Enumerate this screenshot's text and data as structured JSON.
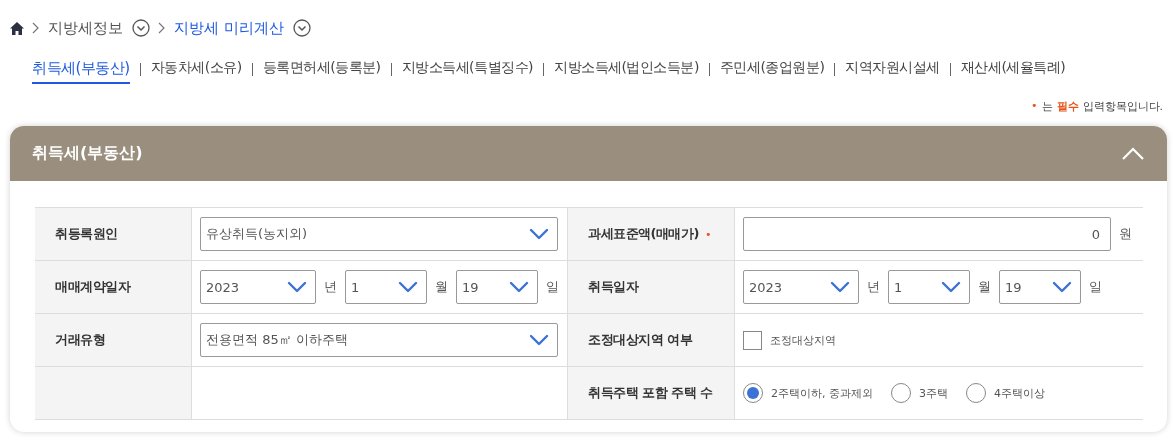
{
  "breadcrumb": [
    {
      "label": "지방세정보",
      "selected": false,
      "has_menu": true
    },
    {
      "label": "지방세 미리계산",
      "selected": true,
      "has_menu": true
    }
  ],
  "tabs": [
    {
      "label": "취득세(부동산)",
      "selected": true
    },
    {
      "label": "자동차세(소유)",
      "selected": false
    },
    {
      "label": "등록면허세(등록분)",
      "selected": false
    },
    {
      "label": "지방소득세(특별징수)",
      "selected": false
    },
    {
      "label": "지방소득세(법인소득분)",
      "selected": false
    },
    {
      "label": "주민세(종업원분)",
      "selected": false
    },
    {
      "label": "지역자원시설세",
      "selected": false
    },
    {
      "label": "재산세(세율특례)",
      "selected": false
    }
  ],
  "required_note": {
    "mark": "•",
    "before": "는",
    "emphasis": "필수",
    "after": "입력항목입니다."
  },
  "panel": {
    "title": "취득세(부동산)",
    "expanded": true,
    "rows": [
      {
        "cells": [
          {
            "label": "취등록원인",
            "field": {
              "kind": "select",
              "value": "유상취득(농지외)"
            }
          },
          {
            "label": "과세표준액(매매가)",
            "required_mark": "•",
            "field": {
              "kind": "text",
              "value": "0",
              "unit": "원"
            }
          }
        ]
      },
      {
        "cells": [
          {
            "label": "매매계약일자",
            "field": {
              "kind": "date",
              "parts": [
                {
                  "value": "2023",
                  "unit": "년"
                },
                {
                  "value": "1",
                  "unit": "월"
                },
                {
                  "value": "19",
                  "unit": "일"
                }
              ]
            }
          },
          {
            "label": "취득일자",
            "field": {
              "kind": "date",
              "parts": [
                {
                  "value": "2023",
                  "unit": "년"
                },
                {
                  "value": "1",
                  "unit": "월"
                },
                {
                  "value": "19",
                  "unit": "일"
                }
              ]
            }
          }
        ]
      },
      {
        "cells": [
          {
            "label": "거래유형",
            "field": {
              "kind": "select",
              "value": "전용면적 85㎡ 이하주택"
            }
          },
          {
            "label": "조정대상지역 여부",
            "field": {
              "kind": "checkbox",
              "label": "조정대상지역",
              "checked": false
            }
          }
        ]
      },
      {
        "cells": [
          {},
          {
            "label": "취득주택 포함 주택 수",
            "field": {
              "kind": "radio",
              "options": [
                {
                  "label": "2주택이하, 중과제외",
                  "selected": true
                },
                {
                  "label": "3주택",
                  "selected": false
                },
                {
                  "label": "4주택이상",
                  "selected": false
                }
              ]
            }
          }
        ]
      }
    ]
  }
}
